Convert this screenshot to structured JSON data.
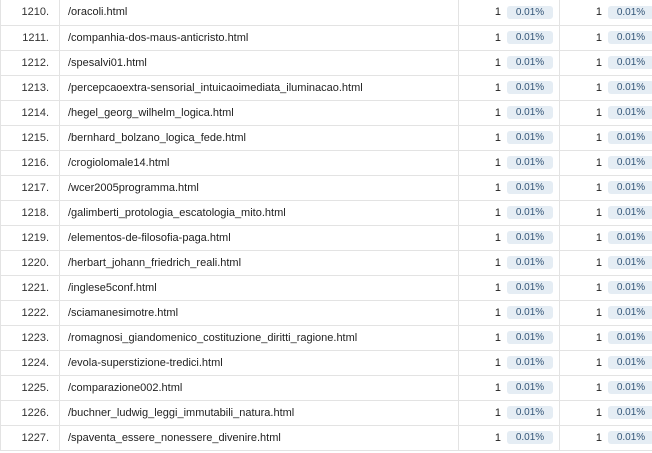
{
  "table": {
    "rows": [
      {
        "index": "1210.",
        "page": "/oracoli.html",
        "col1_value": "1",
        "col1_pct": "0.01%",
        "col2_value": "1",
        "col2_pct": "0.01%"
      },
      {
        "index": "1211.",
        "page": "/companhia-dos-maus-anticristo.html",
        "col1_value": "1",
        "col1_pct": "0.01%",
        "col2_value": "1",
        "col2_pct": "0.01%"
      },
      {
        "index": "1212.",
        "page": "/spesalvi01.html",
        "col1_value": "1",
        "col1_pct": "0.01%",
        "col2_value": "1",
        "col2_pct": "0.01%"
      },
      {
        "index": "1213.",
        "page": "/percepcaoextra-sensorial_intuicaoimediata_iluminacao.html",
        "col1_value": "1",
        "col1_pct": "0.01%",
        "col2_value": "1",
        "col2_pct": "0.01%"
      },
      {
        "index": "1214.",
        "page": "/hegel_georg_wilhelm_logica.html",
        "col1_value": "1",
        "col1_pct": "0.01%",
        "col2_value": "1",
        "col2_pct": "0.01%"
      },
      {
        "index": "1215.",
        "page": "/bernhard_bolzano_logica_fede.html",
        "col1_value": "1",
        "col1_pct": "0.01%",
        "col2_value": "1",
        "col2_pct": "0.01%"
      },
      {
        "index": "1216.",
        "page": "/crogiolomale14.html",
        "col1_value": "1",
        "col1_pct": "0.01%",
        "col2_value": "1",
        "col2_pct": "0.01%"
      },
      {
        "index": "1217.",
        "page": "/wcer2005programma.html",
        "col1_value": "1",
        "col1_pct": "0.01%",
        "col2_value": "1",
        "col2_pct": "0.01%"
      },
      {
        "index": "1218.",
        "page": "/galimberti_protologia_escatologia_mito.html",
        "col1_value": "1",
        "col1_pct": "0.01%",
        "col2_value": "1",
        "col2_pct": "0.01%"
      },
      {
        "index": "1219.",
        "page": "/elementos-de-filosofia-paga.html",
        "col1_value": "1",
        "col1_pct": "0.01%",
        "col2_value": "1",
        "col2_pct": "0.01%"
      },
      {
        "index": "1220.",
        "page": "/herbart_johann_friedrich_reali.html",
        "col1_value": "1",
        "col1_pct": "0.01%",
        "col2_value": "1",
        "col2_pct": "0.01%"
      },
      {
        "index": "1221.",
        "page": "/inglese5conf.html",
        "col1_value": "1",
        "col1_pct": "0.01%",
        "col2_value": "1",
        "col2_pct": "0.01%"
      },
      {
        "index": "1222.",
        "page": "/sciamanesimotre.html",
        "col1_value": "1",
        "col1_pct": "0.01%",
        "col2_value": "1",
        "col2_pct": "0.01%"
      },
      {
        "index": "1223.",
        "page": "/romagnosi_giandomenico_costituzione_diritti_ragione.html",
        "col1_value": "1",
        "col1_pct": "0.01%",
        "col2_value": "1",
        "col2_pct": "0.01%"
      },
      {
        "index": "1224.",
        "page": "/evola-superstizione-tredici.html",
        "col1_value": "1",
        "col1_pct": "0.01%",
        "col2_value": "1",
        "col2_pct": "0.01%"
      },
      {
        "index": "1225.",
        "page": "/comparazione002.html",
        "col1_value": "1",
        "col1_pct": "0.01%",
        "col2_value": "1",
        "col2_pct": "0.01%"
      },
      {
        "index": "1226.",
        "page": "/buchner_ludwig_leggi_immutabili_natura.html",
        "col1_value": "1",
        "col1_pct": "0.01%",
        "col2_value": "1",
        "col2_pct": "0.01%"
      },
      {
        "index": "1227.",
        "page": "/spaventa_essere_nonessere_divenire.html",
        "col1_value": "1",
        "col1_pct": "0.01%",
        "col2_value": "1",
        "col2_pct": "0.01%"
      }
    ]
  }
}
